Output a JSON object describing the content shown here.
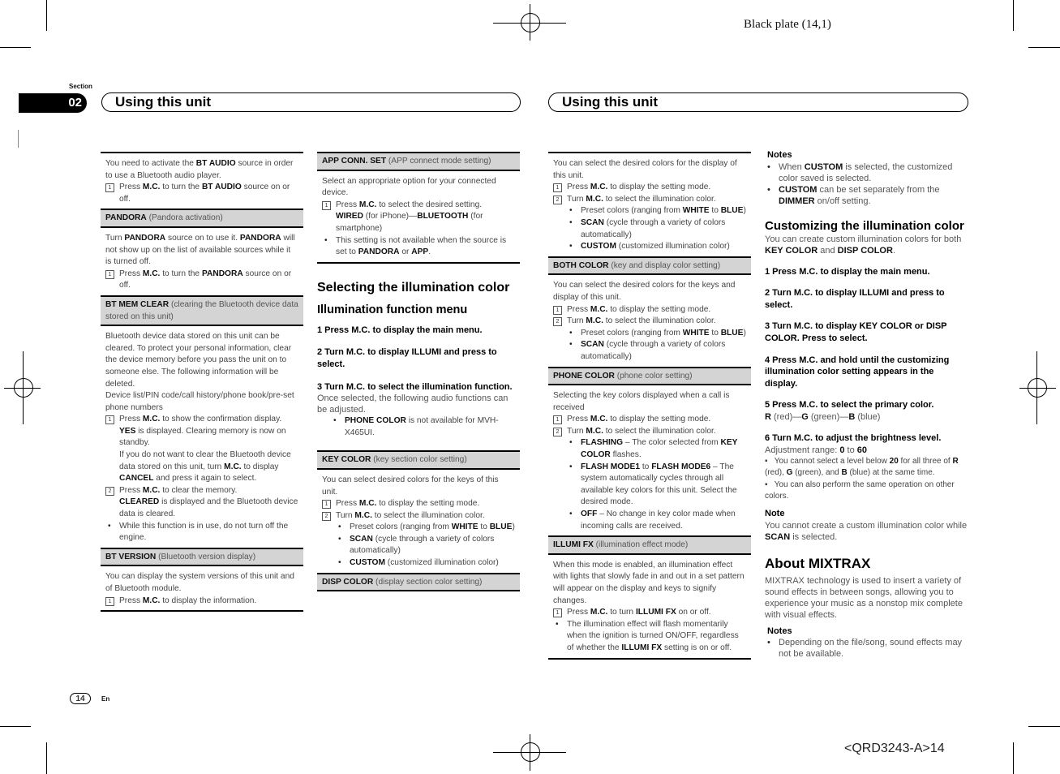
{
  "print": {
    "plate": "Black plate (14,1)",
    "code": "<QRD3243-A>14"
  },
  "header": {
    "section_label": "Section",
    "section_number": "02",
    "left_title": "Using this unit",
    "right_title": "Using this unit"
  },
  "footer": {
    "page_number": "14",
    "language": "En"
  },
  "col1": {
    "bt_audio": {
      "intro_pre": "You need to activate the ",
      "intro_b": "BT AUDIO",
      "intro_post": " source in order to use a Bluetooth audio player.",
      "step1_pre": "Press ",
      "step1_b1": "M.C.",
      "step1_mid": " to turn the ",
      "step1_b2": "BT AUDIO",
      "step1_post": " source on or off."
    },
    "pandora": {
      "title_b": "PANDORA",
      "title_rest": " (Pandora activation)",
      "body_pre": "Turn ",
      "body_b1": "PANDORA",
      "body_mid": " source on to use it. ",
      "body_b2": "PANDORA",
      "body_post": " will not show up on the list of available sources while it is turned off.",
      "step1_pre": "Press ",
      "step1_b1": "M.C.",
      "step1_mid": " to turn the ",
      "step1_b2": "PANDORA",
      "step1_post": " source on or off."
    },
    "bt_mem_clear": {
      "title_b": "BT MEM CLEAR",
      "title_rest": " (clearing the Bluetooth device data stored on this unit)",
      "body": "Bluetooth device data stored on this unit can be cleared. To protect your personal information, clear the device memory before you pass the unit on to someone else. The following information will be deleted.",
      "list": "Device list/PIN code/call history/phone book/pre-set phone numbers",
      "step1_pre": "Press ",
      "step1_b1": "M.C.",
      "step1_post": " to show the confirmation display.",
      "step1_b2": "YES",
      "step1_post2": " is displayed. Clearing memory is now on standby.",
      "step1_cancel_pre": "If you do not want to clear the Bluetooth device data stored on this unit, turn ",
      "step1_cancel_b1": "M.C.",
      "step1_cancel_mid": " to display ",
      "step1_cancel_b2": "CANCEL",
      "step1_cancel_post": " and press it again to select.",
      "step2_pre": "Press ",
      "step2_b1": "M.C.",
      "step2_post": " to clear the memory.",
      "step2_b2": "CLEARED",
      "step2_post2": " is displayed and the Bluetooth device data is cleared.",
      "bullet": "While this function is in use, do not turn off the engine."
    },
    "bt_version": {
      "title_b": "BT VERSION",
      "title_rest": " (Bluetooth version display)",
      "body": "You can display the system versions of this unit and of Bluetooth module.",
      "step1_pre": "Press ",
      "step1_b1": "M.C.",
      "step1_post": " to display the information."
    }
  },
  "col2": {
    "app_conn": {
      "title_b": "APP CONN. SET",
      "title_rest": " (APP connect mode setting)",
      "body": "Select an appropriate option for your connected device.",
      "step1_pre": "Press ",
      "step1_b1": "M.C.",
      "step1_post": " to select the desired setting.",
      "opt_b1": "WIRED",
      "opt_mid": " (for iPhone)—",
      "opt_b2": "BLUETOOTH",
      "opt_post": " (for smartphone)",
      "bullet_pre": "This setting is not available when the source is set to ",
      "bullet_b1": "PANDORA",
      "bullet_mid": " or ",
      "bullet_b2": "APP",
      "bullet_post": "."
    },
    "selecting": {
      "h1": "Selecting the illumination color",
      "h2": "Illumination function menu",
      "s1": "1    Press M.C. to display the main menu.",
      "s2": "2    Turn M.C. to display ILLUMI and press to select.",
      "s3": "3    Turn M.C. to select the illumination function.",
      "after": "Once selected, the following audio functions can be adjusted.",
      "bullet_b": "PHONE COLOR",
      "bullet_post": " is not available for MVH-X465UI."
    },
    "key_color": {
      "title_b": "KEY COLOR",
      "title_rest": " (key section color setting)",
      "body": "You can select desired colors for the keys of this unit.",
      "step1_pre": "Press ",
      "step1_b1": "M.C.",
      "step1_post": " to display the setting mode.",
      "step2_pre": "Turn ",
      "step2_b1": "M.C.",
      "step2_post": " to select the illumination color.",
      "b1_pre": "Preset colors (ranging from ",
      "b1_b1": "WHITE",
      "b1_mid": " to ",
      "b1_b2": "BLUE",
      "b1_post": ")",
      "b2_b": "SCAN",
      "b2_post": " (cycle through a variety of colors automatically)",
      "b3_b": "CUSTOM",
      "b3_post": " (customized illumination color)"
    },
    "disp_color": {
      "title_b": "DISP COLOR",
      "title_rest": " (display section color setting)"
    }
  },
  "col3": {
    "disp_color_body": {
      "body": "You can select the desired colors for the display of this unit.",
      "step1_pre": "Press ",
      "step1_b1": "M.C.",
      "step1_post": " to display the setting mode.",
      "step2_pre": "Turn ",
      "step2_b1": "M.C.",
      "step2_post": " to select the illumination color.",
      "b1_pre": "Preset colors (ranging from ",
      "b1_b1": "WHITE",
      "b1_mid": " to ",
      "b1_b2": "BLUE",
      "b1_post": ")",
      "b2_b": "SCAN",
      "b2_post": " (cycle through a variety of colors automatically)",
      "b3_b": "CUSTOM",
      "b3_post": " (customized illumination color)"
    },
    "both_color": {
      "title_b": "BOTH COLOR",
      "title_rest": " (key and display color setting)",
      "body": "You can select the desired colors for the keys and display of this unit.",
      "step1_pre": "Press ",
      "step1_b1": "M.C.",
      "step1_post": " to display the setting mode.",
      "step2_pre": "Turn ",
      "step2_b1": "M.C.",
      "step2_post": " to select the illumination color.",
      "b1_pre": "Preset colors (ranging from ",
      "b1_b1": "WHITE",
      "b1_mid": " to ",
      "b1_b2": "BLUE",
      "b1_post": ")",
      "b2_b": "SCAN",
      "b2_post": " (cycle through a variety of colors automatically)"
    },
    "phone_color": {
      "title_b": "PHONE COLOR",
      "title_rest": " (phone color setting)",
      "body": "Selecting the key colors displayed when a call is received",
      "step1_pre": "Press ",
      "step1_b1": "M.C.",
      "step1_post": " to display the setting mode.",
      "step2_pre": "Turn ",
      "step2_b1": "M.C.",
      "step2_post": " to select the illumination color.",
      "b1_b1": "FLASHING",
      "b1_mid": " – The color selected from ",
      "b1_b2": "KEY COLOR",
      "b1_post": " flashes.",
      "b2_b1": "FLASH MODE1",
      "b2_mid": " to ",
      "b2_b2": "FLASH MODE6",
      "b2_post": " – The system automatically cycles through all available key colors for this unit. Select the desired mode.",
      "b3_b": "OFF",
      "b3_post": " – No change in key color made when incoming calls are received."
    },
    "illumi_fx": {
      "title_b": "ILLUMI FX",
      "title_rest": " (illumination effect mode)",
      "body": "When this mode is enabled, an illumination effect with lights that slowly fade in and out in a set pattern will appear on the display and keys to signify changes.",
      "step1_pre": "Press ",
      "step1_b1": "M.C.",
      "step1_mid": " to turn ",
      "step1_b2": "ILLUMI FX",
      "step1_post": " on or off.",
      "bullet_pre": "The illumination effect will flash momentarily when the ignition is turned ON/OFF, regardless of whether the ",
      "bullet_b": "ILLUMI FX",
      "bullet_post": " setting is on or off."
    }
  },
  "col4": {
    "notes1": {
      "heading": "Notes",
      "n1_pre": "When ",
      "n1_b": "CUSTOM",
      "n1_post": " is selected, the customized color saved is selected.",
      "n2_b1": "CUSTOM",
      "n2_mid": " can be set separately from the ",
      "n2_b2": "DIMMER",
      "n2_post": " on/off setting."
    },
    "customizing": {
      "h1": "Customizing the illumination color",
      "intro_pre": "You can create custom illumination colors for both ",
      "intro_b1": "KEY COLOR",
      "intro_mid": " and ",
      "intro_b2": "DISP COLOR",
      "intro_post": ".",
      "s1": "1    Press M.C. to display the main menu.",
      "s2": "2    Turn M.C. to display ILLUMI and press to select.",
      "s3": "3    Turn M.C. to display KEY COLOR or DISP COLOR. Press to select.",
      "s4": "4    Press M.C. and hold until the customizing illumination color setting appears in the display.",
      "s5": "5    Press M.C. to select the primary color.",
      "s5_b1": "R",
      "s5_t1": " (red)—",
      "s5_b2": "G",
      "s5_t2": " (green)—",
      "s5_b3": "B",
      "s5_t3": " (blue)",
      "s6": "6    Turn M.C. to adjust the brightness level.",
      "range_pre": "Adjustment range: ",
      "range_min": "0",
      "range_mid": " to ",
      "range_max": "60",
      "sq1_pre": "You cannot select a level below ",
      "sq1_b": "20",
      "sq1_mid": " for all three of ",
      "sq1_r": "R",
      "sq1_t1": " (red), ",
      "sq1_g": "G",
      "sq1_t2": " (green), and ",
      "sq1_bl": "B",
      "sq1_post": " (blue) at the same time.",
      "sq2": "You can also perform the same operation on other colors.",
      "note_heading": "Note",
      "note_pre": "You cannot create a custom illumination color while ",
      "note_b": "SCAN",
      "note_post": " is selected."
    },
    "mixtrax": {
      "h1": "About MIXTRAX",
      "body": "MIXTRAX technology is used to insert a variety of sound effects in between songs, allowing you to experience your music as a nonstop mix complete with visual effects.",
      "notes_heading": "Notes",
      "n1": "Depending on the file/song, sound effects may not be available."
    }
  }
}
